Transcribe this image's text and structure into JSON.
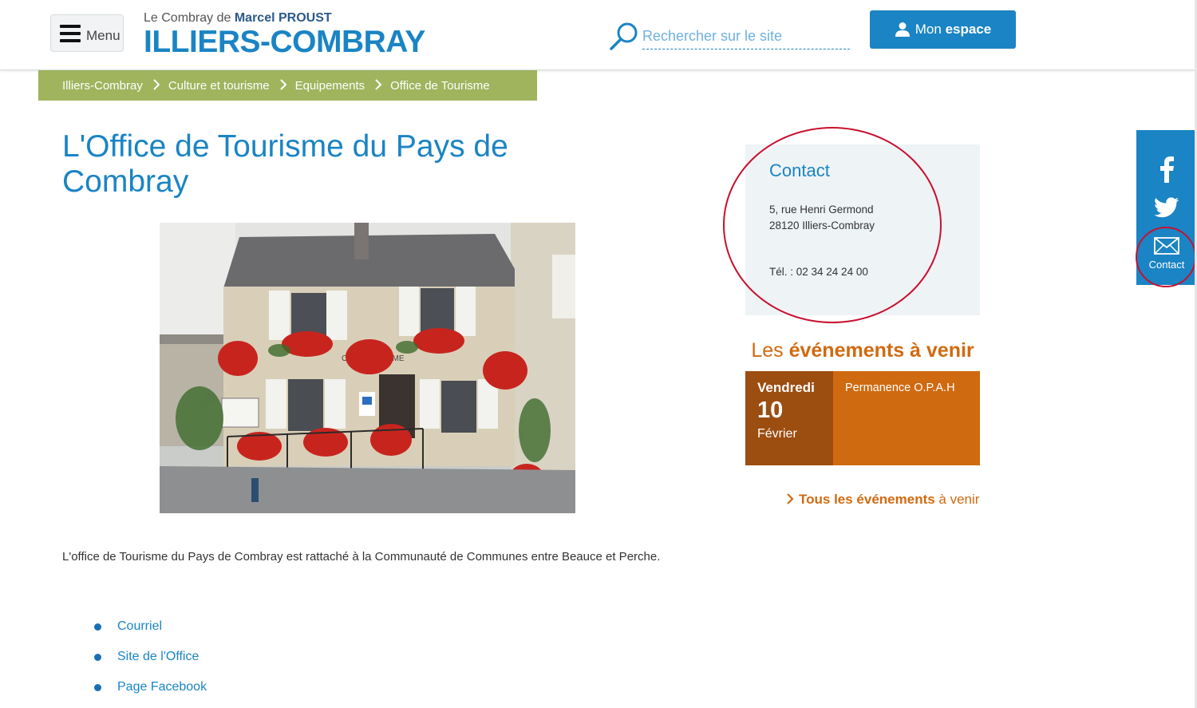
{
  "header": {
    "menu_label": "Menu",
    "tagline_prefix": "Le Combray de ",
    "tagline_name": "Marcel PROUST",
    "site_name": "ILLIERS-COMBRAY",
    "search_placeholder": "Rechercher sur le site",
    "account_label_pre": "Mon ",
    "account_label_bold": "espace"
  },
  "breadcrumb": {
    "items": [
      "Illiers-Combray",
      "Culture et tourisme",
      "Equipements",
      "Office de Tourisme"
    ]
  },
  "main": {
    "title": "L'Office de Tourisme du Pays de Combray",
    "photo_sign_text": "OF     E TOURISME",
    "intro": "L'office de Tourisme du Pays de Combray est rattaché à la Communauté de Communes entre Beauce et Perche.",
    "links": [
      "Courriel",
      "Site de l'Office",
      "Page Facebook"
    ]
  },
  "contact": {
    "title": "Contact",
    "address_line1": "5, rue Henri Germond",
    "address_line2": "28120 Illiers-Combray",
    "phone": "Tél. : 02 34 24 24 00"
  },
  "events": {
    "title_pre": "Les ",
    "title_bold": "événements à venir",
    "items": [
      {
        "day": "Vendredi",
        "num": "10",
        "month": "Février",
        "name": "Permanence O.P.A.H"
      }
    ],
    "all_link_bold": "Tous les événements",
    "all_link_rest": " à venir"
  },
  "socialbar": {
    "items": [
      "facebook-icon",
      "twitter-icon",
      "mail-icon"
    ],
    "contact_label": "Contact"
  },
  "colors": {
    "primary_blue": "#1a84c4",
    "breadcrumb_green": "#9fb45d",
    "event_orange": "#d06a10",
    "event_dark": "#9c4d10",
    "annotation_red": "#c8102e"
  }
}
